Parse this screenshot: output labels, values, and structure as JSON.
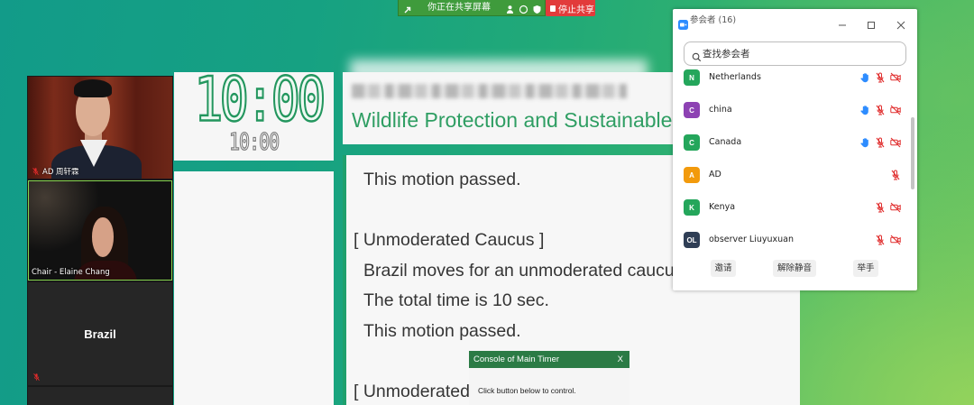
{
  "share_bar": {
    "status": "你正在共享屏幕",
    "stop_label": "停止共享"
  },
  "video_tiles": [
    {
      "label": "AD 周轩霖",
      "mic_muted": true
    },
    {
      "label": "Chair -  Elaine Chang",
      "mic_muted": false,
      "active_speaker": true
    },
    {
      "label": "Brazil",
      "mic_muted": true
    }
  ],
  "timer": {
    "main": "10:00",
    "secondary": "10:00"
  },
  "document": {
    "heading": "Wildlife Protection and Sustainable",
    "lines": [
      "This motion passed.",
      "[ Unmoderated Caucus ]",
      "Brazil moves for an unmoderated caucu",
      "The total time is 10 sec.",
      "This motion passed.",
      "[ Unmoderated"
    ]
  },
  "console_popup": {
    "title": "Console of Main Timer",
    "close_label": "X",
    "hint": "Click button below to control."
  },
  "participants_panel": {
    "title": "参会者 (16)",
    "search_placeholder": "查找参会者",
    "participants": [
      {
        "initials": "N",
        "name": "Netherlands",
        "avatar_color": "#24a65b",
        "hand_raised": true,
        "mic_muted": true,
        "video_off": true
      },
      {
        "initials": "C",
        "name": "china",
        "avatar_color": "#8d42b3",
        "hand_raised": true,
        "mic_muted": true,
        "video_off": true
      },
      {
        "initials": "C",
        "name": "Canada",
        "avatar_color": "#24a65b",
        "hand_raised": true,
        "mic_muted": true,
        "video_off": true
      },
      {
        "initials": "A",
        "name": "AD",
        "avatar_color": "#f29a0c",
        "hand_raised": false,
        "mic_muted": true,
        "video_off": false
      },
      {
        "initials": "K",
        "name": "Kenya",
        "avatar_color": "#24a65b",
        "hand_raised": false,
        "mic_muted": true,
        "video_off": true
      },
      {
        "initials": "OL",
        "name": "observer Liuyuxuan",
        "avatar_color": "#2f3e55",
        "hand_raised": false,
        "mic_muted": true,
        "video_off": true
      }
    ],
    "buttons": {
      "invite": "邀请",
      "unmute": "解除静音",
      "raise_hand": "举手"
    }
  },
  "colors": {
    "accent_green": "#2f9e63",
    "share_bar_green": "#3f9b3c",
    "stop_red": "#e23b3b",
    "muted_red": "#e02b2b",
    "hand_blue": "#2d8cff",
    "active_speaker_border": "#86d44e"
  }
}
